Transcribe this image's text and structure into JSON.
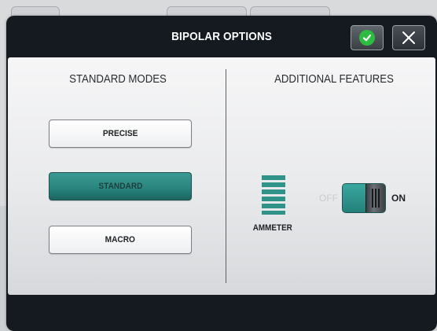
{
  "dialog": {
    "title": "BIPOLAR OPTIONS",
    "ok_icon": "check-icon",
    "close_icon": "close-icon",
    "close_glyph": "✕"
  },
  "standard_modes": {
    "title": "STANDARD MODES",
    "modes": [
      {
        "label": "PRECISE",
        "selected": false
      },
      {
        "label": "STANDARD",
        "selected": true
      },
      {
        "label": "MACRO",
        "selected": false
      }
    ]
  },
  "additional_features": {
    "title": "ADDITIONAL FEATURES",
    "ammeter": {
      "label": "AMMETER",
      "icon": "ammeter-icon"
    },
    "toggle": {
      "off_label": "OFF",
      "on_label": "ON",
      "state": "on"
    }
  },
  "colors": {
    "accent": "#2b8680",
    "titlebar": "#141a20",
    "ok_green": "#2dbb41"
  }
}
